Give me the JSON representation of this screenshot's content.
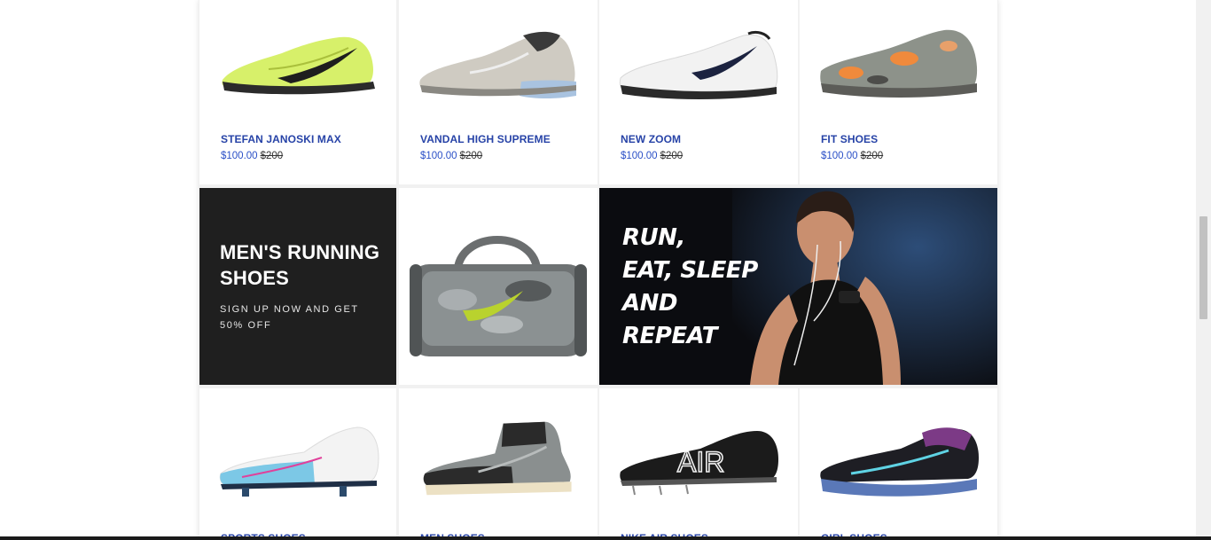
{
  "row1": [
    {
      "name": "STEFAN JANOSKI MAX",
      "price": "$100.00",
      "old_price": "$200",
      "image": "green-turf-shoe"
    },
    {
      "name": "VANDAL HIGH SUPREME",
      "price": "$100.00",
      "old_price": "$200",
      "image": "grey-air-shoe"
    },
    {
      "name": "NEW ZOOM",
      "price": "$100.00",
      "old_price": "$200",
      "image": "white-trainer-shoe"
    },
    {
      "name": "FIT SHOES",
      "price": "$100.00",
      "old_price": "$200",
      "image": "camo-trainer-shoe"
    }
  ],
  "promo": {
    "title_line1": "MEN'S RUNNING",
    "title_line2": "SHOES",
    "subtitle": "SIGN UP NOW AND GET 50% OFF"
  },
  "bag": {
    "image": "camo-duffel-bag"
  },
  "banner": {
    "line1": "RUN,",
    "line2": "EAT, SLEEP",
    "line3": "AND",
    "line4": "REPEAT"
  },
  "row3": [
    {
      "name": "SPORTS SHOES",
      "image": "football-boot"
    },
    {
      "name": "MEN SHOES",
      "image": "dunk-high-shoe"
    },
    {
      "name": "NIKE AIR SHOES",
      "image": "air-spike-shoe"
    },
    {
      "name": "GIRL SHOES",
      "image": "running-shoe-purple"
    }
  ],
  "colors": {
    "accent_blue": "#2743a7",
    "price_blue": "#2b50c7",
    "dark_panel": "#1f1f1f"
  }
}
